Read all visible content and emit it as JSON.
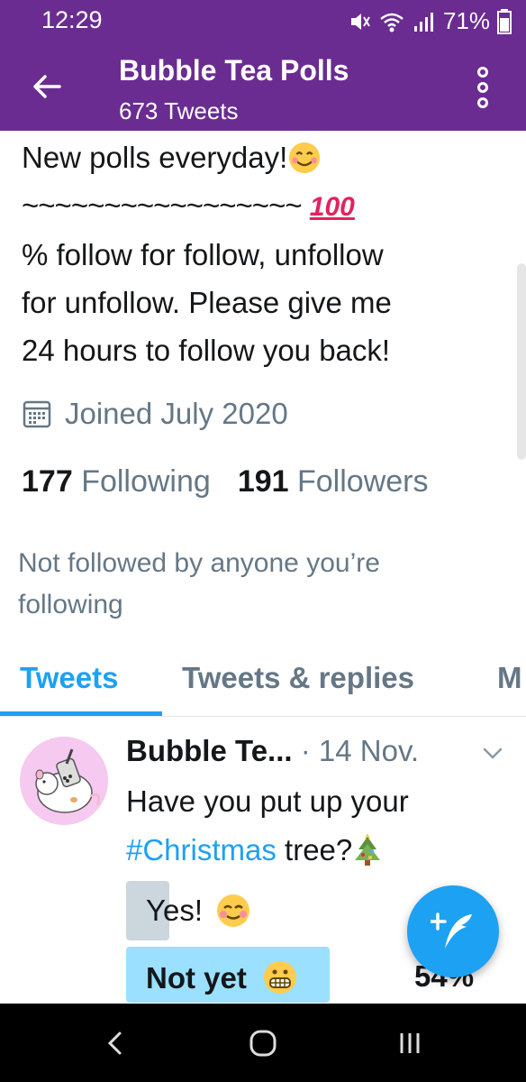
{
  "status_bar": {
    "time": "12:29",
    "battery": "71%",
    "icons": [
      "mute-icon",
      "wifi-icon",
      "signal-icon",
      "battery-icon"
    ]
  },
  "header": {
    "title": "Bubble Tea Polls",
    "subtitle": "673 Tweets",
    "back_icon": "back-arrow-icon",
    "menu_icon": "more-vertical-icon",
    "color": "#6a2c91"
  },
  "profile": {
    "bio_line1": "New polls everyday!",
    "bio_tildes": "~~~~~~~~~~~~~~~~~",
    "bio_hundred": "100",
    "bio_line3": "% follow for follow, unfollow",
    "bio_line4": "for unfollow. Please give me",
    "bio_line5": "24 hours to follow you back!",
    "joined": "Joined July 2020",
    "following_count": "177",
    "following_label": "Following",
    "followers_count": "191",
    "followers_label": "Followers",
    "not_followed": "Not followed by anyone you’re following"
  },
  "tabs": [
    {
      "label": "Tweets",
      "active": true
    },
    {
      "label": "Tweets & replies",
      "active": false
    },
    {
      "label": "M",
      "active": false
    }
  ],
  "tweet": {
    "author": "Bubble Te...",
    "separator": " · ",
    "date": "14 Nov.",
    "text_part1": "Have you put up your",
    "hashtag": "#Christmas",
    "text_part2": " tree?",
    "poll": [
      {
        "label": "Yes!",
        "percent": null,
        "fill": 0.08
      },
      {
        "label": "Not yet",
        "percent": "54%",
        "fill": 0.54
      }
    ]
  },
  "colors": {
    "accent": "#1da1f2",
    "secondary_text": "#657786",
    "poll_winner": "#9be0ff",
    "poll_other": "#ccd6dd"
  },
  "fab": {
    "icon": "compose-tweet-icon"
  },
  "nav_bar": {
    "icons": [
      "back-nav-icon",
      "home-nav-icon",
      "recents-nav-icon"
    ]
  }
}
